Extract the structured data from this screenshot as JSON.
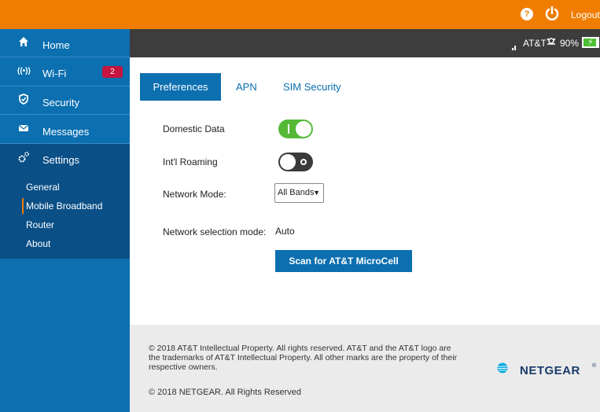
{
  "topbar": {
    "help_icon": "?",
    "logout": "Logout"
  },
  "sidebar": {
    "items": [
      {
        "label": "Home",
        "icon": "home-icon"
      },
      {
        "label": "Wi-Fi",
        "icon": "wifi-icon",
        "badge": "2"
      },
      {
        "label": "Security",
        "icon": "shield-icon"
      },
      {
        "label": "Messages",
        "icon": "envelope-icon"
      },
      {
        "label": "Settings",
        "icon": "gears-icon"
      }
    ],
    "subitems": [
      "General",
      "Mobile Broadband",
      "Router",
      "About"
    ]
  },
  "status": {
    "carrier": "AT&T",
    "battery": "90%",
    "battery_level": 0.9
  },
  "tabs": [
    "Preferences",
    "APN",
    "SIM Security"
  ],
  "form": {
    "domestic_data": {
      "label": "Domestic Data",
      "state": "on"
    },
    "intl_roaming": {
      "label": "Int'l Roaming",
      "state": "off"
    },
    "network_mode": {
      "label": "Network Mode:",
      "value": "All Bands"
    },
    "network_selection": {
      "label": "Network selection mode:",
      "value": "Auto"
    },
    "scan_button": "Scan for AT&T MicroCell"
  },
  "footer": {
    "att_copyright": "© 2018 AT&T Intellectual Property. All rights reserved. AT&T and the AT&T logo are the trademarks of AT&T Intellectual Property. All other marks are the property of their respective owners.",
    "netgear_copyright": "© 2018 NETGEAR. All Rights Reserved",
    "netgear_logo": "NETGEAR",
    "netgear_reg": "®"
  },
  "colors": {
    "accent": "#f07c00",
    "nav": "#0b6fb0",
    "nav_active": "#0a4f86",
    "toggle_on": "#55b937"
  }
}
